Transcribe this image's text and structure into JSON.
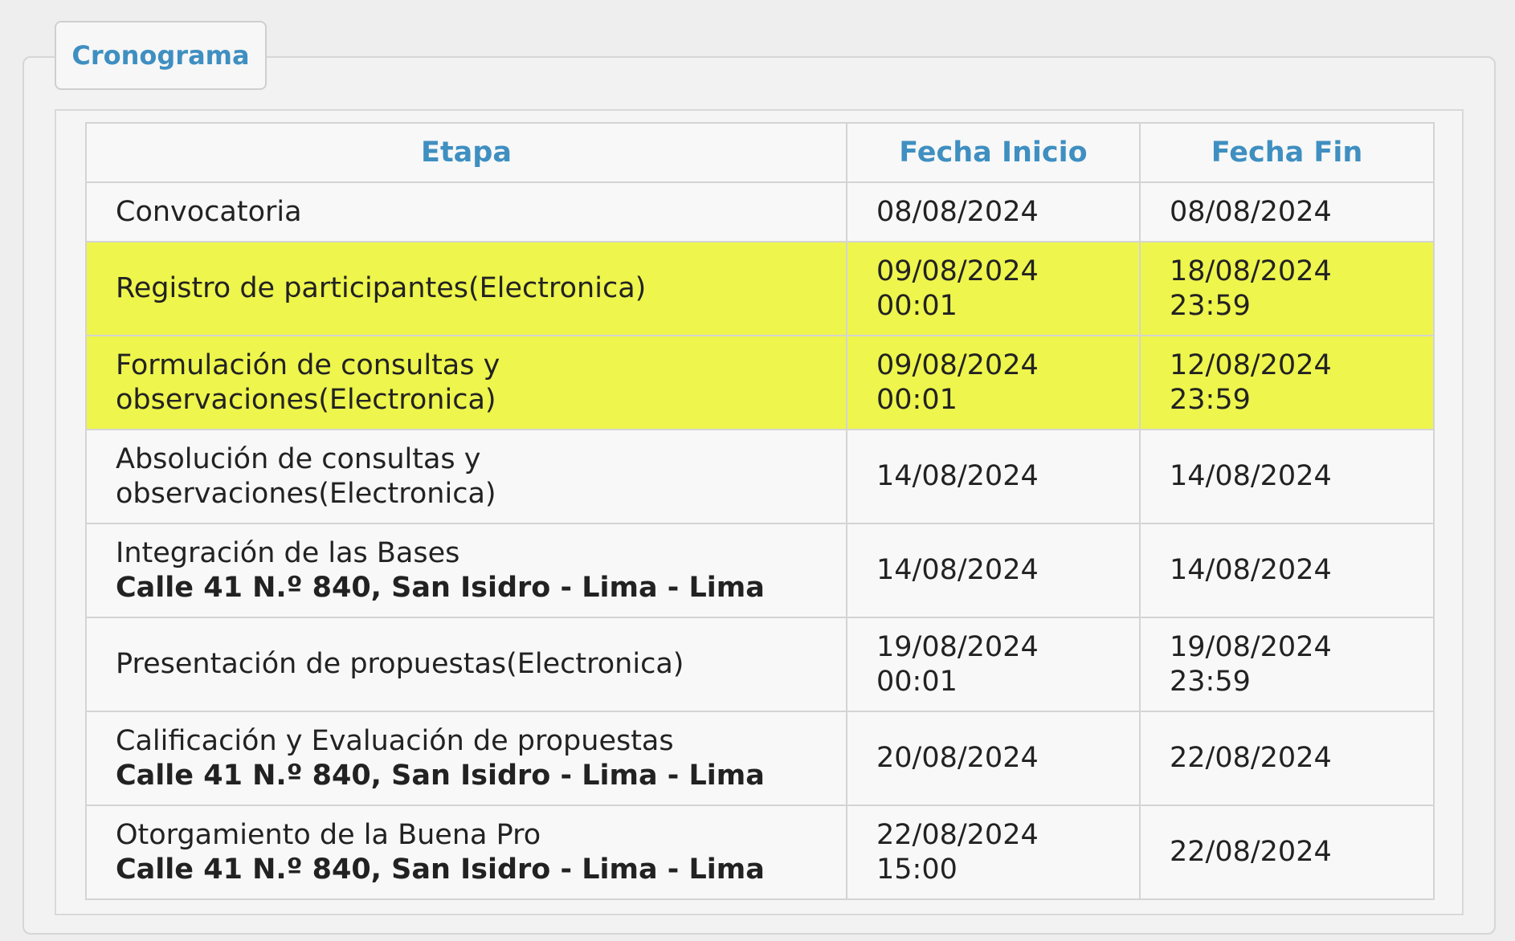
{
  "tab": {
    "label": "Cronograma"
  },
  "table": {
    "headers": {
      "stage": "Etapa",
      "start": "Fecha Inicio",
      "end": "Fecha Fin"
    },
    "rows": [
      {
        "stage_l1": "Convocatoria",
        "stage_l2": "",
        "address": "",
        "start_date": "08/08/2024",
        "start_time": "",
        "end_date": "08/08/2024",
        "end_time": "",
        "highlight": false
      },
      {
        "stage_l1": "Registro de participantes(Electronica)",
        "stage_l2": "",
        "address": "",
        "start_date": "09/08/2024",
        "start_time": "00:01",
        "end_date": "18/08/2024",
        "end_time": "23:59",
        "highlight": true
      },
      {
        "stage_l1": "Formulación de consultas y",
        "stage_l2": "observaciones(Electronica)",
        "address": "",
        "start_date": "09/08/2024",
        "start_time": "00:01",
        "end_date": "12/08/2024",
        "end_time": "23:59",
        "highlight": true
      },
      {
        "stage_l1": "Absolución de consultas y",
        "stage_l2": "observaciones(Electronica)",
        "address": "",
        "start_date": "14/08/2024",
        "start_time": "",
        "end_date": "14/08/2024",
        "end_time": "",
        "highlight": false
      },
      {
        "stage_l1": "Integración de las Bases",
        "stage_l2": "",
        "address": "Calle 41 N.º 840, San Isidro - Lima - Lima",
        "start_date": "14/08/2024",
        "start_time": "",
        "end_date": "14/08/2024",
        "end_time": "",
        "highlight": false
      },
      {
        "stage_l1": "Presentación de propuestas(Electronica)",
        "stage_l2": "",
        "address": "",
        "start_date": "19/08/2024",
        "start_time": "00:01",
        "end_date": "19/08/2024",
        "end_time": "23:59",
        "highlight": false
      },
      {
        "stage_l1": "Calificación y Evaluación de propuestas",
        "stage_l2": "",
        "address": "Calle 41 N.º 840, San Isidro - Lima - Lima",
        "start_date": "20/08/2024",
        "start_time": "",
        "end_date": "22/08/2024",
        "end_time": "",
        "highlight": false
      },
      {
        "stage_l1": "Otorgamiento de la Buena Pro",
        "stage_l2": "",
        "address": "Calle 41 N.º 840, San Isidro - Lima - Lima",
        "start_date": "22/08/2024",
        "start_time": "15:00",
        "end_date": "22/08/2024",
        "end_time": "",
        "highlight": false
      }
    ]
  },
  "colors": {
    "highlight": "#eef54c",
    "header_text": "#3f8fc1",
    "body_text": "#222222"
  }
}
